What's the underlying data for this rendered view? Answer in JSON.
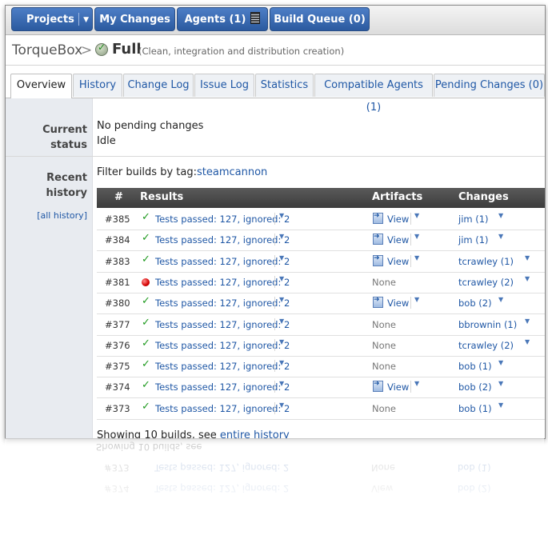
{
  "nav": {
    "projects": "Projects",
    "my_changes": "My Changes",
    "agents": "Agents (1)",
    "build_queue": "Build Queue (0)"
  },
  "breadcrumb": {
    "project": "TorqueBox",
    "build": "Full",
    "description": "(Clean, integration and distribution creation)"
  },
  "tabs": [
    {
      "label": "Overview"
    },
    {
      "label": "History"
    },
    {
      "label": "Change Log"
    },
    {
      "label": "Issue Log"
    },
    {
      "label": "Statistics"
    },
    {
      "label": "Compatible Agents (1)"
    },
    {
      "label": "Pending Changes (0)"
    }
  ],
  "current_status": {
    "label_line1": "Current",
    "label_line2": "status",
    "line1": "No pending changes",
    "line2": "Idle"
  },
  "recent_history": {
    "label_line1": "Recent",
    "label_line2": "history",
    "all_history": "[all history]",
    "filter_label": "Filter builds by tag:",
    "filter_tag": "steamcannon",
    "columns": {
      "num": "#",
      "results": "Results",
      "artifacts": "Artifacts",
      "changes": "Changes"
    },
    "rows": [
      {
        "num": "#385",
        "status": "success",
        "result": "Tests passed: 127, ignored: 2",
        "artifacts": "View",
        "changes": "jim (1)"
      },
      {
        "num": "#384",
        "status": "success",
        "result": "Tests passed: 127, ignored: 2",
        "artifacts": "View",
        "changes": "jim (1)"
      },
      {
        "num": "#383",
        "status": "success",
        "result": "Tests passed: 127, ignored: 2",
        "artifacts": "View",
        "changes": "tcrawley (1)"
      },
      {
        "num": "#381",
        "status": "failure",
        "result": "Tests passed: 127, ignored: 2",
        "artifacts": "None",
        "changes": "tcrawley (2)"
      },
      {
        "num": "#380",
        "status": "success",
        "result": "Tests passed: 127, ignored: 2",
        "artifacts": "View",
        "changes": "bob (2)"
      },
      {
        "num": "#377",
        "status": "success",
        "result": "Tests passed: 127, ignored: 2",
        "artifacts": "None",
        "changes": "bbrownin (1)"
      },
      {
        "num": "#376",
        "status": "success",
        "result": "Tests passed: 127, ignored: 2",
        "artifacts": "None",
        "changes": "tcrawley (2)"
      },
      {
        "num": "#375",
        "status": "success",
        "result": "Tests passed: 127, ignored: 2",
        "artifacts": "None",
        "changes": "bob (1)"
      },
      {
        "num": "#374",
        "status": "success",
        "result": "Tests passed: 127, ignored: 2",
        "artifacts": "View",
        "changes": "bob (2)"
      },
      {
        "num": "#373",
        "status": "success",
        "result": "Tests passed: 127, ignored: 2",
        "artifacts": "None",
        "changes": "bob (1)"
      }
    ],
    "footer_prefix": "Showing 10 builds, see",
    "footer_link": "entire history"
  },
  "icons": {
    "success": "check-icon",
    "failure": "red-dot-icon",
    "ok_status": "check-circle-icon",
    "artifact": "view-artifact-icon",
    "agents": "agent-monitor-icon"
  },
  "colors": {
    "nav_blue": "#2b5a9f",
    "link": "#1f57a5",
    "success": "#1f9a1f",
    "failure": "#d40000",
    "table_header": "#3c3c3c"
  }
}
